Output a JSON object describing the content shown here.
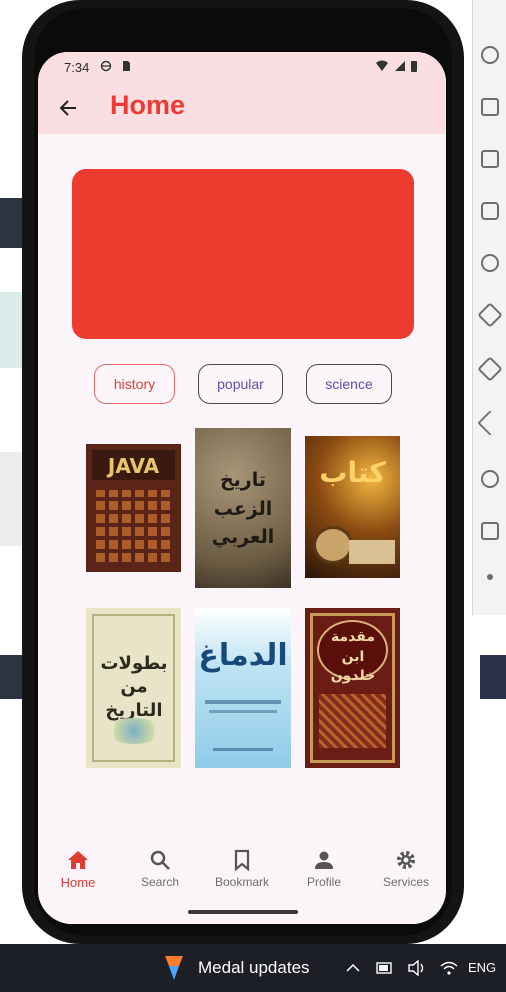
{
  "status_bar": {
    "time": "7:34"
  },
  "app_bar": {
    "title": "Home"
  },
  "colors": {
    "accent": "#ec3b32",
    "banner": "#ee3b2f",
    "chip_text": "#5e51a8"
  },
  "chips": [
    {
      "label": "history",
      "selected": true
    },
    {
      "label": "popular",
      "selected": false
    },
    {
      "label": "science",
      "selected": false
    }
  ],
  "books": [
    {
      "title": "JAVA"
    },
    {
      "title": "تاريخ الزعب العربي"
    },
    {
      "title": "كتاب"
    },
    {
      "title": "بطولات من التاريخ"
    },
    {
      "title": "الدماغ"
    },
    {
      "title": "مقدمة ابن خلدون"
    }
  ],
  "bottom_nav": [
    {
      "label": "Home",
      "icon": "home-icon",
      "active": true
    },
    {
      "label": "Search",
      "icon": "search-icon",
      "active": false
    },
    {
      "label": "Bookmark",
      "icon": "bookmark-icon",
      "active": false
    },
    {
      "label": "Profile",
      "icon": "profile-icon",
      "active": false
    },
    {
      "label": "Services",
      "icon": "gear-icon",
      "active": false
    }
  ],
  "taskbar": {
    "notification": "Medal updates",
    "language": "ENG"
  }
}
